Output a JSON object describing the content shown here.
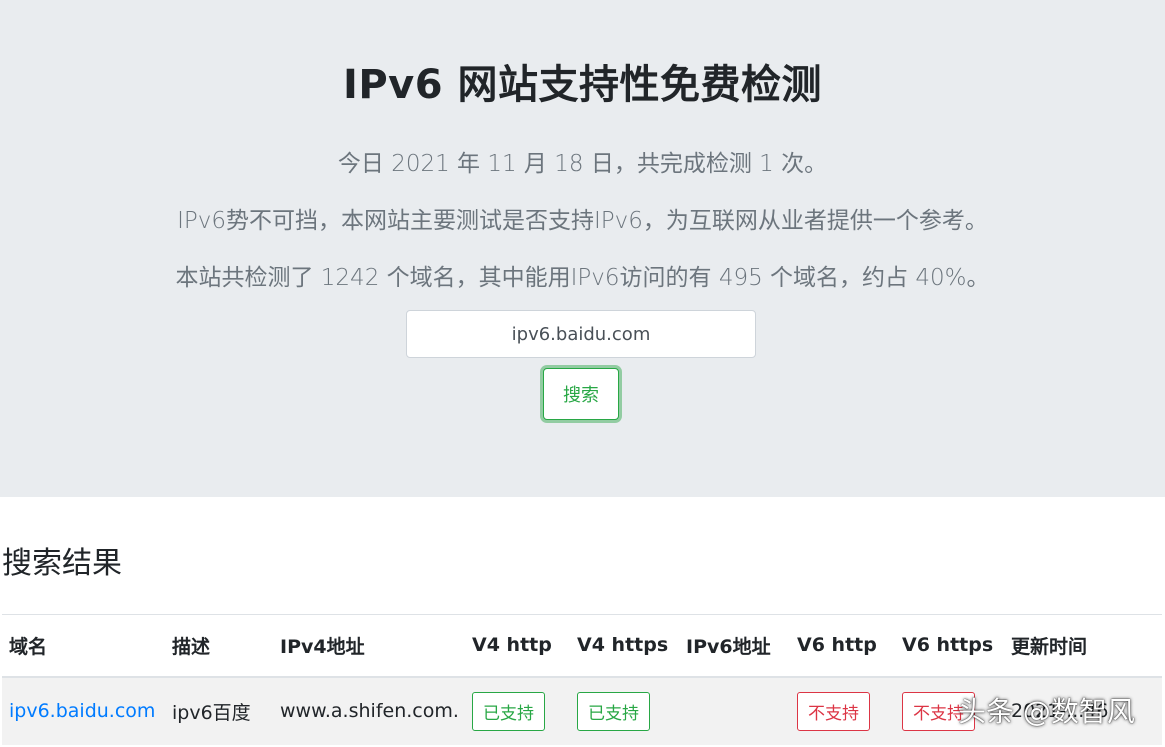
{
  "hero": {
    "title": "IPv6 网站支持性免费检测",
    "line1": "今日 2021 年 11 月 18 日，共完成检测 1 次。",
    "line2": "IPv6势不可挡，本网站主要测试是否支持IPv6，为互联网从业者提供一个参考。",
    "line3": "本站共检测了 1242 个域名，其中能用IPv6访问的有 495 个域名，约占 40%。"
  },
  "search": {
    "value": "ipv6.baidu.com",
    "button_label": "搜索"
  },
  "results": {
    "heading": "搜索结果",
    "columns": [
      "域名",
      "描述",
      "IPv4地址",
      "V4 http",
      "V4 https",
      "IPv6地址",
      "V6 http",
      "V6 https",
      "更新时间"
    ],
    "rows": [
      {
        "domain": "ipv6.baidu.com",
        "description": "ipv6百度",
        "ipv4": "www.a.shifen.com.",
        "v4_http": "已支持",
        "v4_https": "已支持",
        "ipv6": "",
        "v6_http": "不支持",
        "v6_https": "不支持",
        "updated": "2021-...46"
      }
    ]
  },
  "watermark": "头条 @数智风",
  "colors": {
    "hero_bg": "#e9ecef",
    "success": "#28a745",
    "danger": "#dc3545",
    "link": "#007bff"
  }
}
